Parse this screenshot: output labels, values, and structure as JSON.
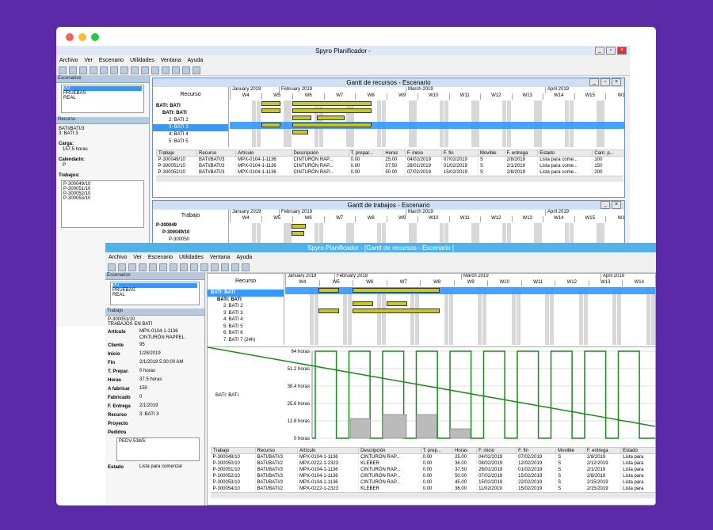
{
  "back": {
    "title": "Spyro Planificador -",
    "menu": [
      "Archivo",
      "Ver",
      "Escenario",
      "Utilidades",
      "Ventana",
      "Ayuda"
    ],
    "escenarios_label": "Escenarios",
    "escenarios": [
      "PU",
      "PRUEBAS",
      "REAL"
    ],
    "recurso_label": "Recurso",
    "recurso_lines": [
      "BATI/BATI/3",
      "3: BATI 3"
    ],
    "carga_label": "Carga:",
    "carga": "157.5 horas",
    "calendario_label": "Calendario:",
    "calendario": "P",
    "trabajos_label": "Trabajos:",
    "trabajos": [
      "P-300049/10",
      "P-300051/10",
      "P-300052/10",
      "P-300053/10"
    ],
    "gantt1_title": "Gantt de recursos - Escenario",
    "gantt1_col": "Recurso",
    "gantt1_rows": [
      "BATI: BATI",
      "BATI: BATI",
      "2: BATI 2",
      "3: BATI 3",
      "4: BATI 4",
      "5: BATI 5"
    ],
    "months": [
      "January 2019",
      "February 2019",
      "March 2019",
      "April 2019"
    ],
    "weeks": [
      "W4",
      "W5",
      "W6",
      "W7",
      "W8",
      "W9",
      "W10",
      "W11",
      "W12",
      "W13",
      "W14",
      "W15",
      "W1"
    ],
    "grid1_headers": [
      "Trabajo",
      "Recurso",
      "Artículo",
      "Descripción",
      "T. prepar...",
      "Horas",
      "F. inicio",
      "F. fin",
      "Movible",
      "F. entrega",
      "Estado",
      "Cant. p..."
    ],
    "grid1_rows": [
      [
        "P-300049/10",
        "BATI/BATI/3",
        "MPX-0104-1-1136",
        "CINTURÓN RAP...",
        "0.00",
        "25.00",
        "04/02/2019",
        "07/02/2019",
        "S",
        "2/8/2019",
        "Lista para come...",
        "100"
      ],
      [
        "P-300051/10",
        "BATI/BATI/3",
        "MPX-0104-1-1136",
        "CINTURÓN RAP...",
        "0.00",
        "37.50",
        "28/01/2019",
        "01/02/2019",
        "S",
        "2/1/2019",
        "Lista para come...",
        "150"
      ],
      [
        "P-300052/10",
        "BATI/BATI/3",
        "MPX-0104-1-1136",
        "CINTURÓN RAP...",
        "0.00",
        "50.00",
        "07/02/2019",
        "15/02/2019",
        "S",
        "2/8/2019",
        "Lista para come...",
        "200"
      ]
    ],
    "gantt2_title": "Gantt de trabajos - Escenario",
    "gantt2_col": "Trabajo",
    "gantt2_rows": [
      "P-300049",
      "P-300049/10",
      "P-300050"
    ]
  },
  "front": {
    "title": "Spyro Planificador - [Gantt de recursos - Escenario ]",
    "menu": [
      "Archivo",
      "Ver",
      "Escenario",
      "Utilidades",
      "Ventana",
      "Ayuda"
    ],
    "escenarios_label": "Escenarios",
    "escenarios": [
      "PU",
      "PRUEBAS",
      "REAL"
    ],
    "trabajo_label": "Trabajo",
    "trabajo_lines": [
      "P-300051/10",
      "TRABAJOS EN BATI"
    ],
    "fields": [
      {
        "k": "Artículo",
        "v": "MPX-0104-1-1136"
      },
      {
        "k": "",
        "v": "CINTURÓN RAPPEL"
      },
      {
        "k": "Cliente",
        "v": "95"
      },
      {
        "k": "Inicio",
        "v": "1/28/2019"
      },
      {
        "k": "Fin",
        "v": "2/1/2019 5:30:00 AM"
      },
      {
        "k": "T. Prepar.",
        "v": "0 horas"
      },
      {
        "k": "Horas",
        "v": "37.5 horas"
      },
      {
        "k": "A fabricar",
        "v": "150"
      },
      {
        "k": "Fabricado",
        "v": "0"
      },
      {
        "k": "F. Entrega",
        "v": "2/1/2019"
      },
      {
        "k": "Recurso",
        "v": "3: BATI 3"
      },
      {
        "k": "Proyecto",
        "v": ""
      },
      {
        "k": "Pedidos",
        "v": ""
      }
    ],
    "pedido": "PEDV-538/5:",
    "estado_label": "Estado",
    "estado": "Lista para comenzar",
    "gantt_col": "Recurso",
    "gantt_rows": [
      "BATI: BATI",
      "BATI: BATI",
      "2: BATI 2",
      "3: BATI 3",
      "4: BATI 4",
      "5: BATI 5",
      "6: BATI 6",
      "7: BATI 7 (24h)"
    ],
    "months": [
      "January 2019",
      "February 2019",
      "March 2019",
      "April 2019"
    ],
    "weeks": [
      "W4",
      "W5",
      "W6",
      "W7",
      "W8",
      "W9",
      "W10",
      "W11",
      "W12",
      "W13",
      "W14"
    ],
    "load_label": "BATI: BATI",
    "y_ticks": [
      "64 horas",
      "51.2 horas",
      "38.4 horas",
      "25.6 horas",
      "12.8 horas",
      "0 horas"
    ],
    "grid_headers": [
      "Trabajo",
      "Recurso",
      "Artículo",
      "Descripción",
      "T. prep...",
      "Horas",
      "F. inicio",
      "F. fin",
      "Movible",
      "F. entrega",
      "Estado"
    ],
    "grid_rows": [
      [
        "P-300049/10",
        "BATI/BATI/3",
        "MPX-0104-1-1136",
        "CINTURÓN RAP...",
        "0.00",
        "25.00",
        "04/02/2019",
        "07/02/2019",
        "S",
        "2/8/2019",
        "Lista para"
      ],
      [
        "P-300050/10",
        "BATI/BATI/2",
        "MPX-0222-1-2323",
        "KLEBER",
        "0.00",
        "36.00",
        "08/02/2019",
        "12/02/2019",
        "S",
        "2/12/2019",
        "Lista para"
      ],
      [
        "P-300051/10",
        "BATI/BATI/3",
        "MPX-0104-1-1136",
        "CINTURÓN RAP...",
        "0.00",
        "37.50",
        "28/01/2019",
        "01/02/2019",
        "S",
        "2/1/2019",
        "Lista para"
      ],
      [
        "P-300052/10",
        "BATI/BATI/3",
        "MPX-0104-1-1136",
        "CINTURÓN RAP...",
        "0.00",
        "50.00",
        "07/02/2019",
        "15/02/2019",
        "S",
        "2/8/2019",
        "Lista para"
      ],
      [
        "P-300053/10",
        "BATI/BATI/3",
        "MPX-0104-1-1136",
        "CINTURÓN RAP...",
        "0.00",
        "45.00",
        "15/02/2019",
        "22/02/2019",
        "S",
        "2/15/2019",
        "Lista para"
      ],
      [
        "P-300054/10",
        "BATI/BATI/2",
        "MPX-0222-1-2323",
        "KLEBER",
        "0.00",
        "36.00",
        "11/02/2019",
        "15/02/2019",
        "S",
        "2/15/2019",
        "Lista para"
      ]
    ]
  }
}
